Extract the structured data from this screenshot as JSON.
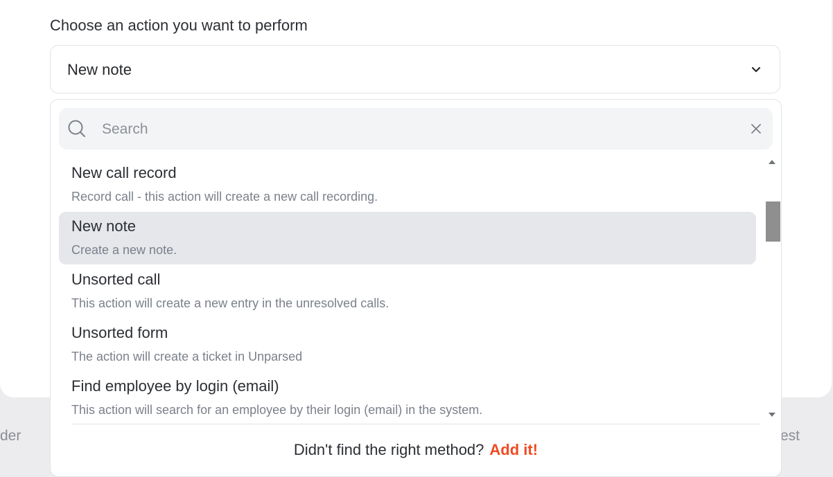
{
  "background": {
    "left_text": "der",
    "right_text": "est"
  },
  "prompt": "Choose an action you want to perform",
  "select": {
    "value": "New note",
    "chevron_icon": "chevron-down-icon"
  },
  "search": {
    "placeholder": "Search",
    "value": "",
    "icon": "search-icon",
    "clear_icon": "close-icon"
  },
  "actions": [
    {
      "title": "New call record",
      "description": "Record call - this action will create a new call recording.",
      "selected": false
    },
    {
      "title": "New note",
      "description": "Create a new note.",
      "selected": true
    },
    {
      "title": "Unsorted call",
      "description": "This action will create a new entry in the unresolved calls.",
      "selected": false
    },
    {
      "title": "Unsorted form",
      "description": "The action will create a ticket in Unparsed",
      "selected": false
    },
    {
      "title": "Find employee by login (email)",
      "description": "This action will search for an employee by their login (email) in the system.",
      "selected": false
    }
  ],
  "footer": {
    "text": "Didn't find the right method?",
    "link": "Add it!"
  },
  "colors": {
    "accent": "#f04a23",
    "selected_bg": "#e5e7eb",
    "search_bg": "#f3f4f6",
    "backdrop": "#ececef"
  }
}
